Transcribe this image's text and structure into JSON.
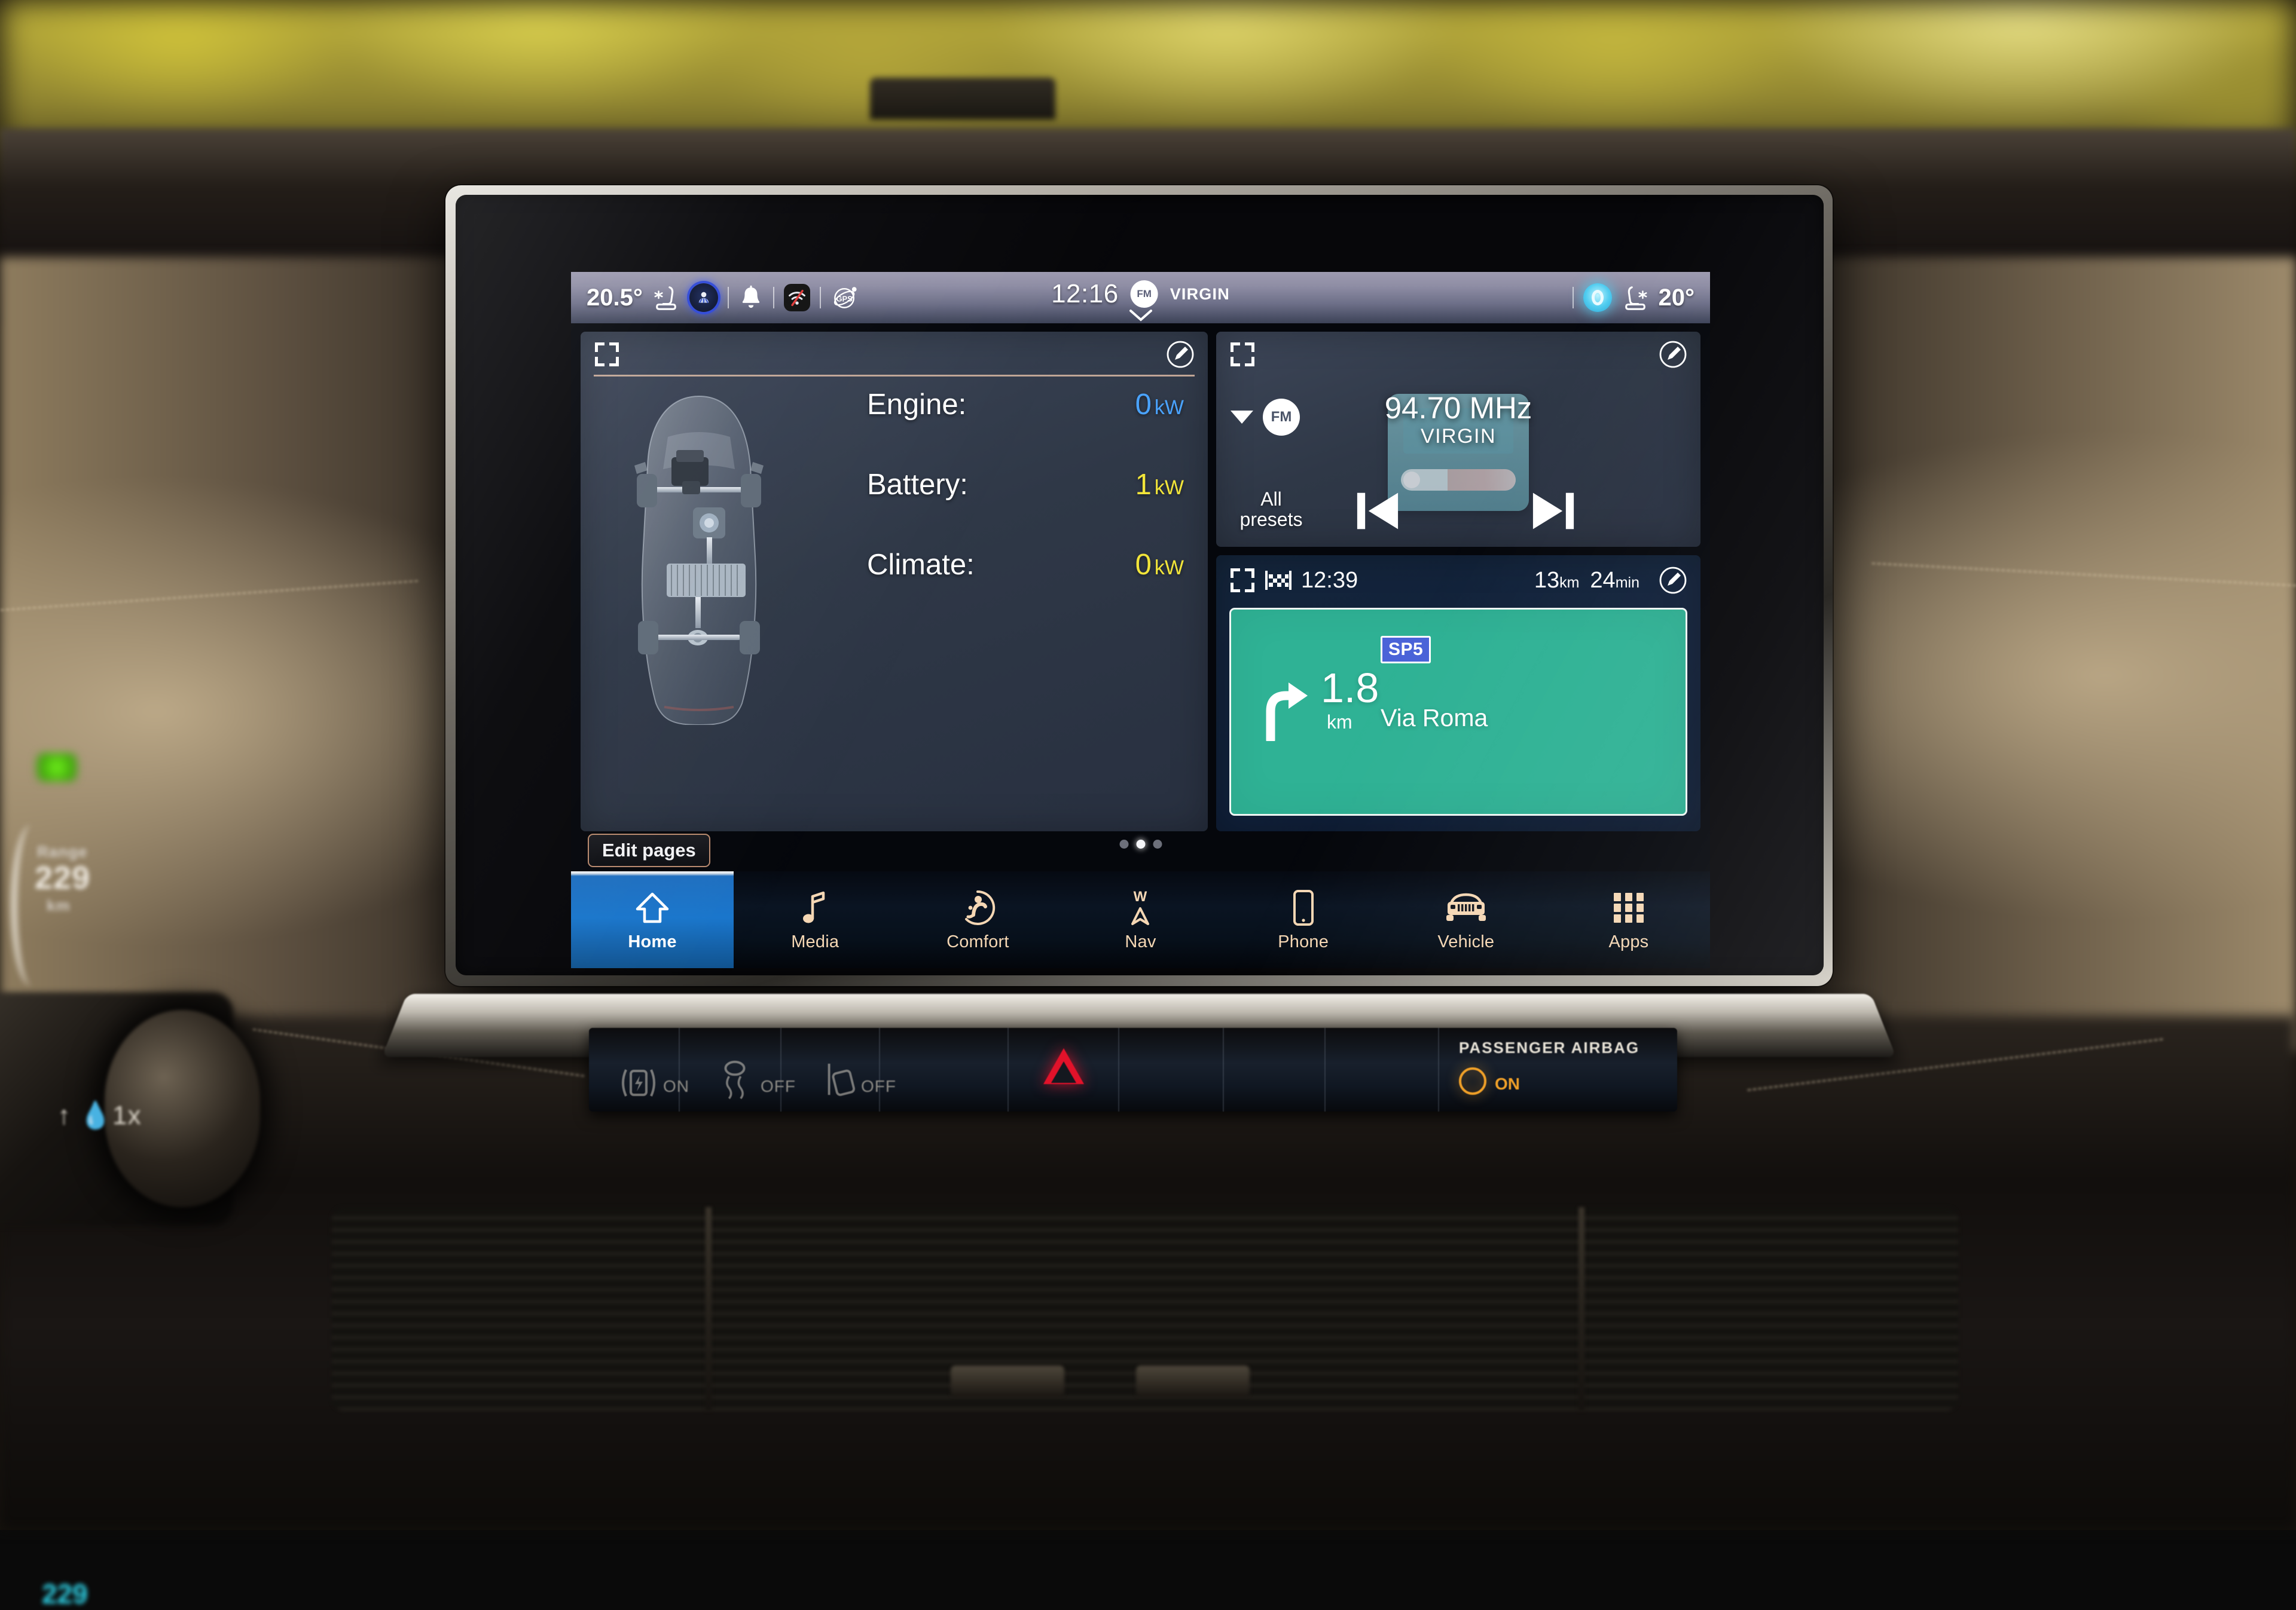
{
  "status_bar": {
    "left_temperature": "20.5°",
    "right_temperature": "20°",
    "clock": "12:16",
    "now_playing_band": "FM",
    "now_playing_station": "VIRGIN",
    "icons": {
      "driver_seat_climate": "seat-climate-icon",
      "profile": "profile-icon",
      "notifications": "bell-icon",
      "wifi_off": "wifi-off-icon",
      "gps": "gps-icon",
      "voice_assistant": "voice-assistant-icon",
      "passenger_seat_climate": "seat-climate-icon",
      "expand_status": "chevron-down-icon"
    }
  },
  "energy_widget": {
    "title": "",
    "rows": [
      {
        "label": "Engine:",
        "value": "0",
        "unit": "kW",
        "color": "#4aa3ff"
      },
      {
        "label": "Battery:",
        "value": "1",
        "unit": "kW",
        "color": "#f2e53a"
      },
      {
        "label": "Climate:",
        "value": "0",
        "unit": "kW",
        "color": "#f2e53a"
      }
    ],
    "vehicle_graphic": "hybrid-powertrain-top-view"
  },
  "radio_widget": {
    "band": "FM",
    "frequency": "94.70 MHz",
    "station_name": "VIRGIN",
    "presets_label_line1": "All",
    "presets_label_line2": "presets",
    "prev_icon": "skip-previous-icon",
    "next_icon": "skip-next-icon",
    "band_selector_icon": "caret-down-icon"
  },
  "nav_widget": {
    "arrival_time": "12:39",
    "remaining_distance": "13",
    "remaining_distance_unit": "km",
    "remaining_time": "24",
    "remaining_time_unit": "min",
    "maneuver_distance": "1.8",
    "maneuver_distance_unit": "km",
    "road_shield": "SP5",
    "street_name": "Via Roma",
    "maneuver_icon": "turn-right-icon",
    "destination_icon": "checkered-flag-icon",
    "banner_color": "#2fb295"
  },
  "page_controls": {
    "edit_pages_label": "Edit pages",
    "page_count": 3,
    "active_page_index": 1
  },
  "tab_bar": {
    "tabs": [
      {
        "label": "Home",
        "icon": "home-icon",
        "active": true
      },
      {
        "label": "Media",
        "icon": "music-note-icon",
        "active": false
      },
      {
        "label": "Comfort",
        "icon": "seated-person-icon",
        "active": false
      },
      {
        "label": "Nav",
        "icon": "compass-icon",
        "active": false
      },
      {
        "label": "Phone",
        "icon": "phone-icon",
        "active": false
      },
      {
        "label": "Vehicle",
        "icon": "jeep-front-icon",
        "active": false
      },
      {
        "label": "Apps",
        "icon": "grid-apps-icon",
        "active": false
      }
    ]
  },
  "physical_controls": {
    "auto_hold_label": "ON",
    "traction_off_label": "OFF",
    "parking_sensor_off_label": "OFF",
    "hazard_icon": "hazard-triangle-icon",
    "passenger_airbag_label": "PASSENGER AIRBAG",
    "passenger_airbag_state": "ON"
  },
  "instrument_cluster": {
    "range_label": "Range",
    "range_value": "229",
    "range_unit": "km",
    "secondary_value": "229"
  },
  "wiper_stalk": {
    "glyph": "wiper-single-wipe-icon"
  },
  "colors": {
    "accent_blue": "#1a76cc",
    "tab_icon_tan": "#f5d7b4",
    "nav_green": "#2fb295",
    "rule_tan": "#d9b9a3",
    "hazard_red": "#e2122a",
    "airbag_amber": "#f0a028"
  }
}
